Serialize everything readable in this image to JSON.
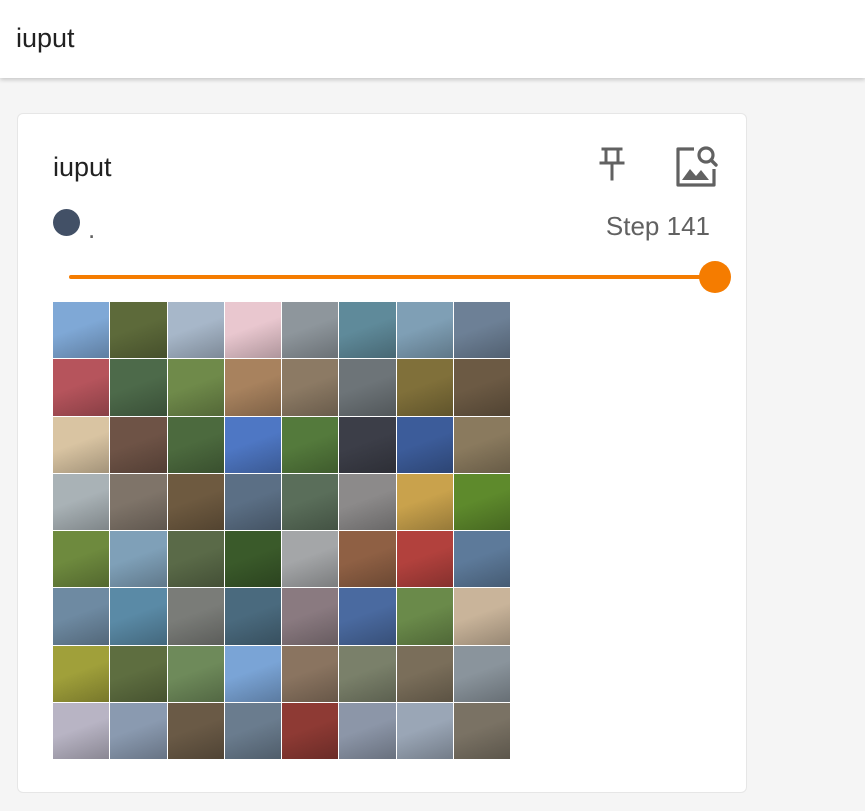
{
  "header": {
    "title": "iuput"
  },
  "card": {
    "title": "iuput",
    "pin_icon": "pin-icon",
    "image_search_icon": "image-search-icon",
    "run": {
      "name": ".",
      "color": "#425066"
    },
    "step_text": "Step 141",
    "slider_value": 1.0,
    "accent": "#f57c00"
  },
  "image_grid": {
    "rows": 8,
    "cols": 8,
    "tile_colors": [
      [
        "#7fa8d6",
        "#5d6a3a",
        "#a7b7c9",
        "#e9c7cf",
        "#8e969c",
        "#5f8a9a",
        "#7f9fb5",
        "#6d8096"
      ],
      [
        "#b6545c",
        "#4d6a4a",
        "#6f8a4a",
        "#a8825e",
        "#8c7a64",
        "#6d7478",
        "#80703a",
        "#6c5a44"
      ],
      [
        "#d9c4a2",
        "#6e5346",
        "#4c6a3e",
        "#4e77c4",
        "#547a3c",
        "#3c3e48",
        "#3c5c9a",
        "#8a7a5e"
      ],
      [
        "#a9b2b6",
        "#7f7469",
        "#6e5a40",
        "#5b6f85",
        "#5a6e5a",
        "#8c8a8a",
        "#c9a24c",
        "#5e8a2c"
      ],
      [
        "#6e8a3e",
        "#7fa0b8",
        "#5a6a48",
        "#3a5a2a",
        "#a4a6a8",
        "#8f6044",
        "#b2413d",
        "#5d7a9a"
      ],
      [
        "#6e8aa2",
        "#5a8aa6",
        "#7a7c78",
        "#4a6a7e",
        "#8a7a80",
        "#4a6aa0",
        "#6a8a4a",
        "#c9b49a"
      ],
      [
        "#a0a03a",
        "#5e6e40",
        "#6e8a5a",
        "#7aa4d6",
        "#8a7460",
        "#7a806a",
        "#7a6e5a",
        "#8a949c"
      ],
      [
        "#b8b4c4",
        "#8a9ab0",
        "#6a5a46",
        "#6a7c8e",
        "#8e3a34",
        "#8c96a8",
        "#9aa6b6",
        "#7a7264"
      ]
    ]
  }
}
